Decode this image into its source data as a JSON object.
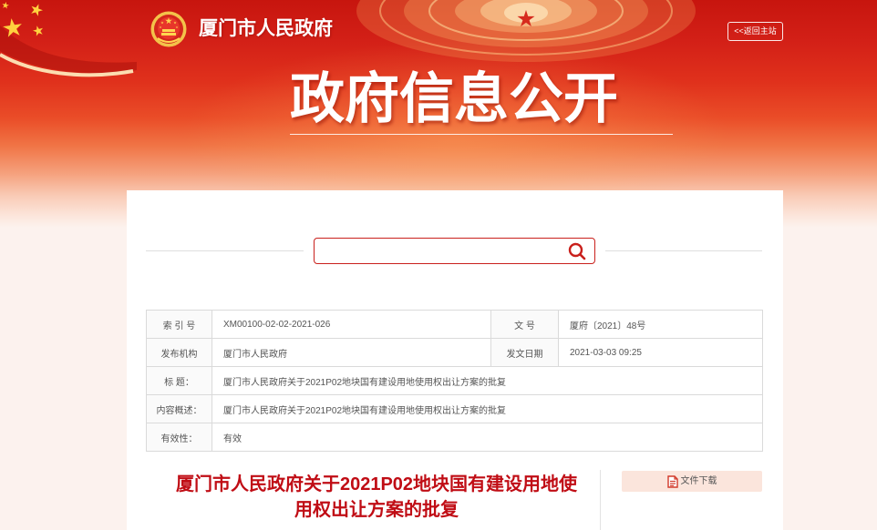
{
  "header": {
    "site_name": "厦门市人民政府",
    "back_link": "<<返回主站",
    "banner_title": "政府信息公开"
  },
  "search": {
    "value": ""
  },
  "info_table": {
    "index_no": {
      "label": "索 引 号",
      "value": "XM00100-02-02-2021-026"
    },
    "doc_no": {
      "label": "文 号",
      "value": "厦府〔2021〕48号"
    },
    "publisher": {
      "label": "发布机构",
      "value": "厦门市人民政府"
    },
    "issue_date": {
      "label": "发文日期",
      "value": "2021-03-03 09:25"
    },
    "title": {
      "label": "标 题：",
      "value": "厦门市人民政府关于2021P02地块国有建设用地使用权出让方案的批复"
    },
    "summary": {
      "label": "内容概述：",
      "value": "厦门市人民政府关于2021P02地块国有建设用地使用权出让方案的批复"
    },
    "validity": {
      "label": "有效性：",
      "value": "有效"
    }
  },
  "article": {
    "title": "厦门市人民政府关于2021P02地块国有建设用地使用权出让方案的批复"
  },
  "download": {
    "label": "文件下载"
  },
  "icons": {
    "emblem": "national-emblem-icon",
    "stars": "star-icon",
    "search": "search-icon",
    "download": "document-icon"
  },
  "colors": {
    "banner_red": "#d42418",
    "accent_red": "#c9201c",
    "title_red": "#c00d15",
    "download_bg": "#fbe5dc",
    "panel_bg": "#ffffff"
  }
}
